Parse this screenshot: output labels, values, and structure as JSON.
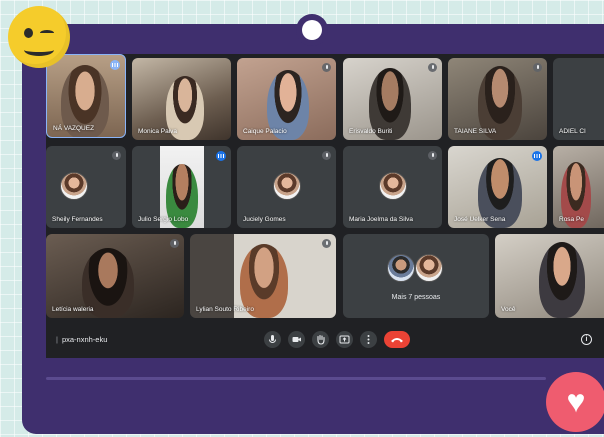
{
  "meeting": {
    "code": "pxa-nxnh-eku",
    "separator": "|"
  },
  "participants": [
    {
      "name": "NÁ VAZQUEZ",
      "status": "more-options"
    },
    {
      "name": "Monica Paiva",
      "status": "none"
    },
    {
      "name": "Caique Palacio",
      "status": "muted"
    },
    {
      "name": "Erisvaldo Buriti",
      "status": "muted"
    },
    {
      "name": "TAIANE SILVA",
      "status": "muted"
    },
    {
      "name": "ADIEL CI",
      "status": "none"
    },
    {
      "name": "Sheily Fernandes",
      "status": "muted"
    },
    {
      "name": "Julio Sergio Lobo",
      "status": "speaking"
    },
    {
      "name": "Juciely Gomes",
      "status": "muted"
    },
    {
      "name": "Maria Joelma da Silva",
      "status": "muted"
    },
    {
      "name": "José Uelker Sena",
      "status": "speaking"
    },
    {
      "name": "Rosa Pe",
      "status": "none"
    },
    {
      "name": "Letícia waleria",
      "status": "muted"
    },
    {
      "name": "Lylian Souto Ribeiro",
      "status": "muted"
    },
    {
      "name": "Mais 7 pessoas",
      "status": "group"
    },
    {
      "name": "Você",
      "status": "none"
    }
  ],
  "controls": {
    "mic_icon": "mic-icon",
    "camera_icon": "camera-icon",
    "hand_icon": "raise-hand-icon",
    "present_icon": "present-screen-icon",
    "more_icon": "more-options-icon",
    "end_call_icon": "end-call-icon",
    "info_label": "i"
  },
  "decor": {
    "emoji": "winking-face-emoji",
    "heart_icon": "heart-icon",
    "frame_color": "#3f2f6e",
    "end_call_color": "#ea4335",
    "speaking_color": "#1a73e8",
    "heart_button_color": "#ef5c6f"
  }
}
